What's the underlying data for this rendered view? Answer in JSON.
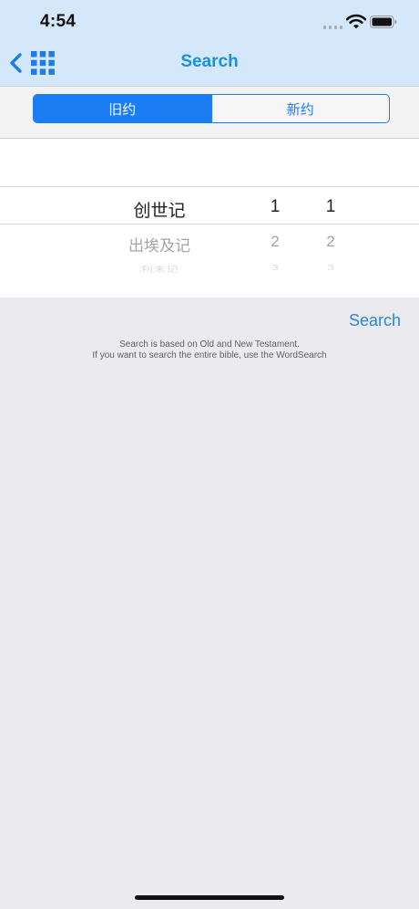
{
  "status_bar": {
    "time": "4:54"
  },
  "nav": {
    "title": "Search",
    "back_icon": "chevron-left-icon",
    "grid_icon": "grid-icon"
  },
  "segments": [
    {
      "label": "旧约",
      "selected": true
    },
    {
      "label": "新约",
      "selected": false
    }
  ],
  "picker": {
    "books": [
      "创世记",
      "出埃及记",
      "利未记"
    ],
    "chapters": [
      "1",
      "2",
      "3"
    ],
    "verses": [
      "1",
      "2",
      "3"
    ]
  },
  "search_button": "Search",
  "notes": [
    "Search is based on Old and New Testament.",
    "If you want to search the entire bible, use the WordSearch"
  ],
  "colors": {
    "accent": "#1C7CF4",
    "title": "#1A8FE3",
    "nav_background": "#D5E7FB",
    "page_background": "#EAEAEF"
  }
}
